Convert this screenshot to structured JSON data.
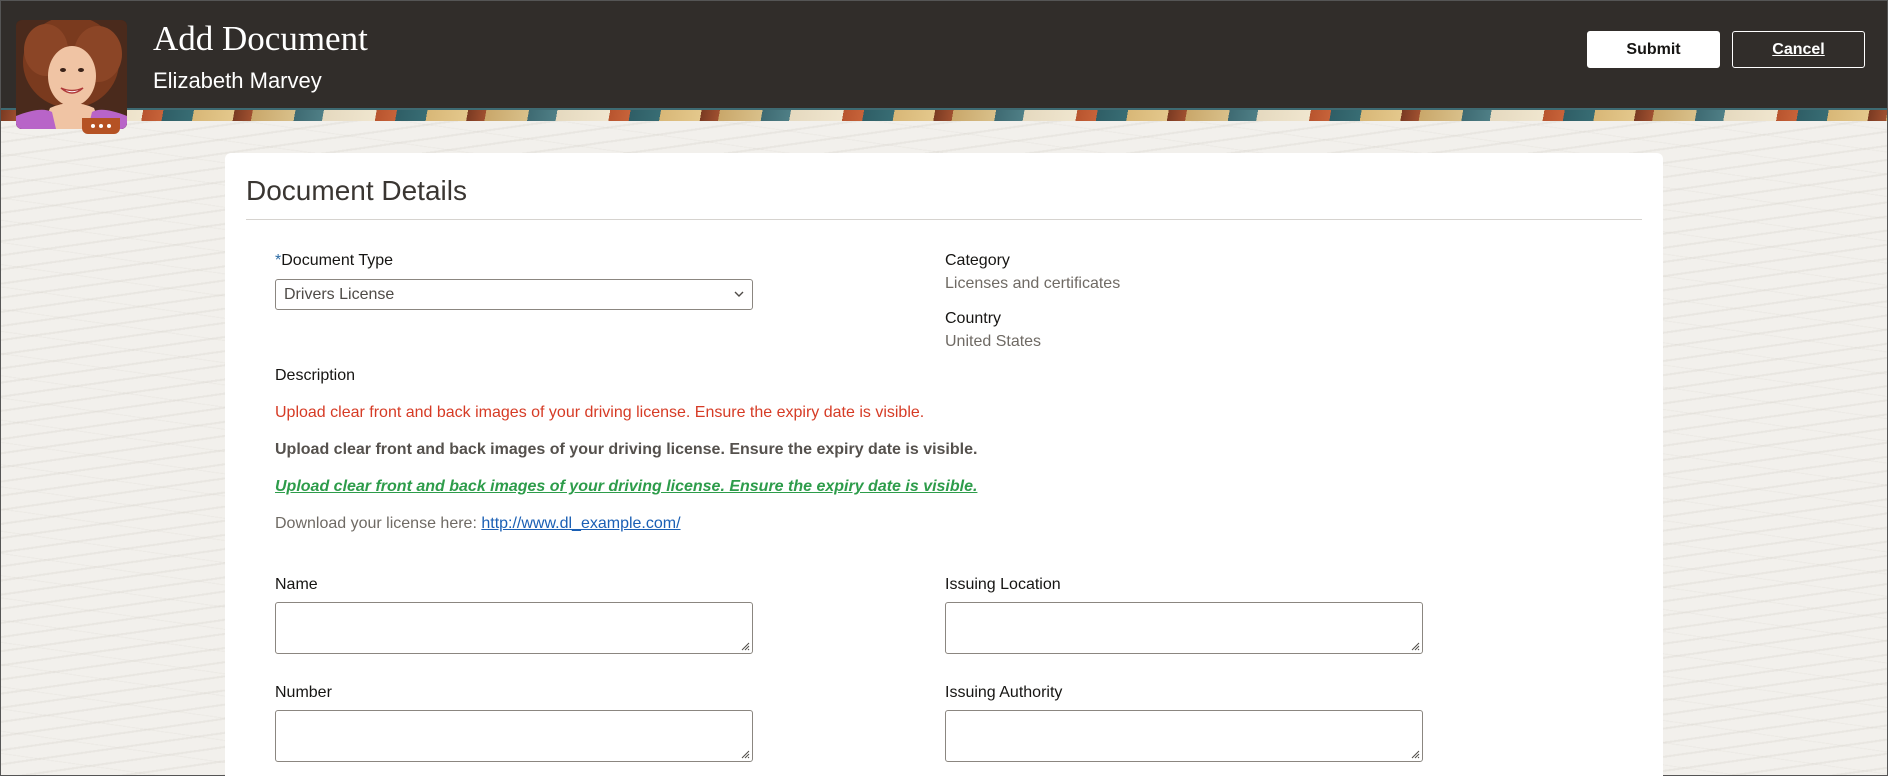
{
  "header": {
    "title": "Add Document",
    "subtitle": "Elizabeth Marvey",
    "submit_label": "Submit",
    "cancel_label": "Cancel"
  },
  "section": {
    "title": "Document Details"
  },
  "form": {
    "document_type_label": "Document Type",
    "required_mark": "*",
    "document_type_value": "Drivers License",
    "category_label": "Category",
    "category_value": "Licenses and certificates",
    "country_label": "Country",
    "country_value": "United States",
    "description_label": "Description",
    "description_lines": [
      "Upload clear front and back images of your driving license. Ensure the expiry date is visible.",
      "Upload clear front and back images of your driving license. Ensure the expiry date is visible.",
      "Upload clear front and back images of your driving license. Ensure the expiry date is visible."
    ],
    "download_text": "Download your license here:",
    "download_link": "http://www.dl_example.com/",
    "name_label": "Name",
    "name_value": "",
    "issuing_location_label": "Issuing Location",
    "issuing_location_value": "",
    "number_label": "Number",
    "number_value": "",
    "issuing_authority_label": "Issuing Authority",
    "issuing_authority_value": ""
  },
  "colors": {
    "header_bg": "#312d2a",
    "desc_red": "#d63b25",
    "desc_green": "#2d9c4a",
    "link": "#1a5fb4"
  }
}
